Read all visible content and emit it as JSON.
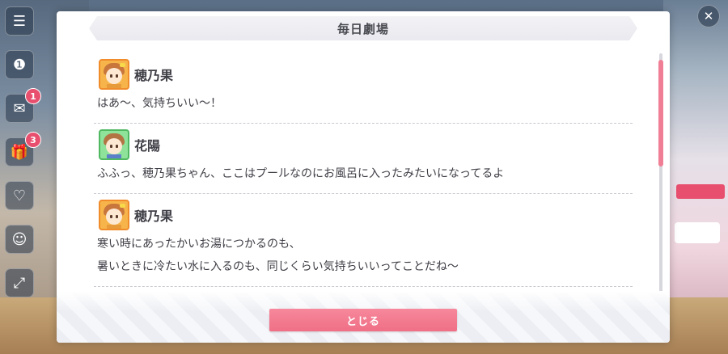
{
  "dialog": {
    "title": "毎日劇場",
    "close_label": "とじる"
  },
  "messages": [
    {
      "speaker": "穂乃果",
      "avatar": "orange",
      "lines": [
        "はあ〜、気持ちいい〜！"
      ]
    },
    {
      "speaker": "花陽",
      "avatar": "green",
      "lines": [
        "ふふっ、穂乃果ちゃん、ここはプールなのにお風呂に入ったみたいになってるよ"
      ]
    },
    {
      "speaker": "穂乃果",
      "avatar": "orange",
      "lines": [
        "寒い時にあったかいお湯につかるのも、",
        "暑いときに冷たい水に入るのも、同じくらい気持ちいいってことだね〜"
      ]
    }
  ],
  "left_menu": {
    "badges": [
      "1",
      "3"
    ]
  },
  "colors": {
    "accent": "#ef6f86",
    "scroll_thumb": "#f07f95",
    "text": "#3e3e46"
  }
}
